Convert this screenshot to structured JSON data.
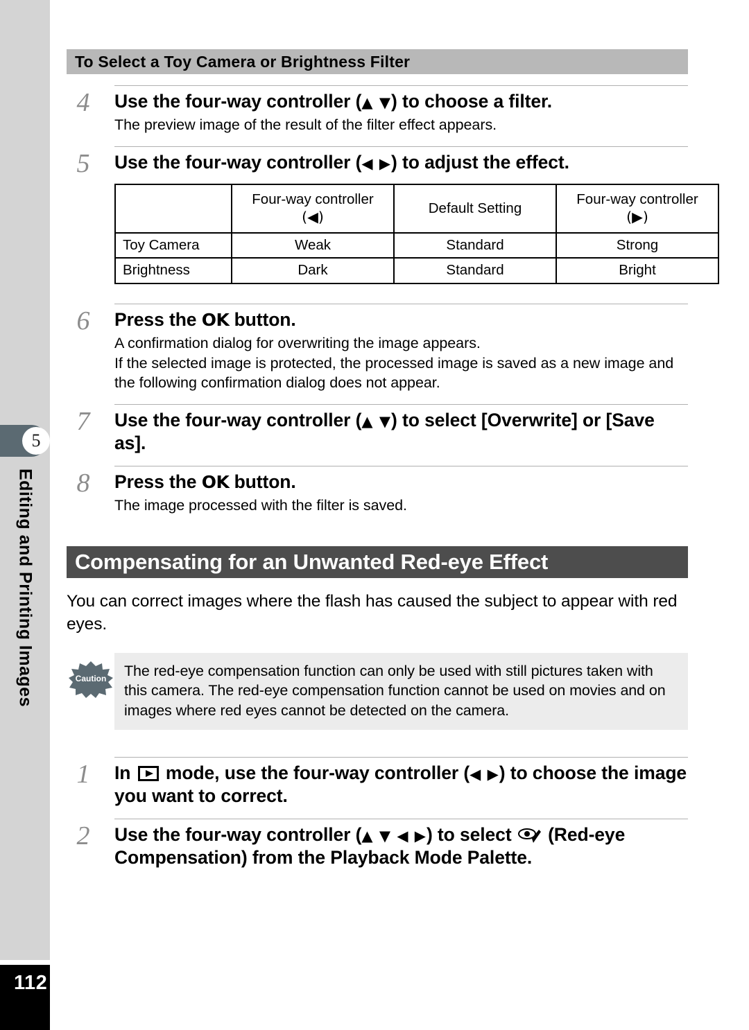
{
  "sidebar": {
    "chapter_number": "5",
    "chapter_title": "Editing and Printing Images",
    "page_number": "112"
  },
  "subheading": "To Select a Toy Camera or Brightness Filter",
  "steps_filter": [
    {
      "number": "4",
      "title_pre": "Use the four-way controller (",
      "title_arrows": "▲ ▼",
      "title_post": ") to choose a filter.",
      "body": [
        "The preview image of the result of the filter effect appears."
      ]
    },
    {
      "number": "5",
      "title_pre": "Use the four-way controller (",
      "title_arrows": "◀ ▶",
      "title_post": ") to adjust the effect.",
      "body": []
    },
    {
      "number": "6",
      "title_pre": "Press the ",
      "title_ok": "OK",
      "title_post": " button.",
      "body": [
        "A confirmation dialog for overwriting the image appears.",
        "If the selected image is protected, the processed image is saved as a new image and the following confirmation dialog does not appear."
      ]
    },
    {
      "number": "7",
      "title_pre": "Use the four-way controller (",
      "title_arrows": "▲ ▼",
      "title_post": ") to select [Overwrite] or [Save as].",
      "body": []
    },
    {
      "number": "8",
      "title_pre": "Press the ",
      "title_ok": "OK",
      "title_post": " button.",
      "body": [
        "The image processed with the filter is saved."
      ]
    }
  ],
  "table": {
    "headers": [
      {
        "label": "",
        "arrow": ""
      },
      {
        "label": "Four-way controller",
        "arrow": "(◀)"
      },
      {
        "label": "Default Setting",
        "arrow": ""
      },
      {
        "label": "Four-way controller",
        "arrow": "(▶)"
      }
    ],
    "rows": [
      [
        "Toy Camera",
        "Weak",
        "Standard",
        "Strong"
      ],
      [
        "Brightness",
        "Dark",
        "Standard",
        "Bright"
      ]
    ]
  },
  "section": {
    "heading": "Compensating for an Unwanted Red-eye Effect",
    "intro": "You can correct images where the flash has caused the subject to appear with red eyes."
  },
  "caution": {
    "badge_label": "Caution",
    "text": "The red-eye compensation function can only be used with still pictures taken with this camera. The red-eye compensation function cannot be used on movies and on images where red eyes cannot be detected on the camera."
  },
  "steps_redeye": [
    {
      "number": "1",
      "title_pre": "In ",
      "title_icon": "playback-mode-icon",
      "title_mid": " mode, use the four-way controller (",
      "title_arrows": "◀ ▶",
      "title_post": ") to choose the image you want to correct."
    },
    {
      "number": "2",
      "title_pre": "Use the four-way controller (",
      "title_arrows": "▲ ▼ ◀ ▶",
      "title_mid": ") to select ",
      "title_icon": "red-eye-compensation-icon",
      "title_post": " (Red-eye Compensation) from the Playback Mode Palette."
    }
  ],
  "colors": {
    "sidebar_bg": "#d4d4d4",
    "chapter_tab": "#5b6a72",
    "subhead_bar": "#b8b8b8",
    "section_bar": "#4d4d4d",
    "caution_bg": "#ececec",
    "step_number": "#8c8c8c",
    "page_block": "#000000"
  }
}
